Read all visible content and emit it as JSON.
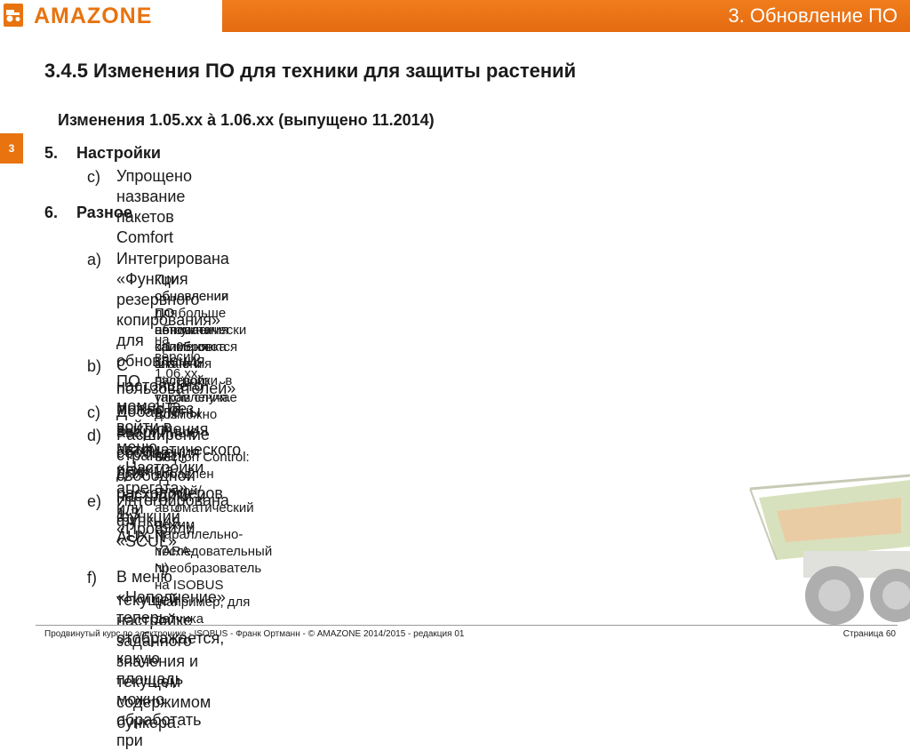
{
  "header": {
    "brand": "AMAZONE",
    "section": "3.  Обновление ПО"
  },
  "chapter_tab": "3",
  "title": "3.4.5 Изменения ПО для техники для защиты растений",
  "subtitle": "Изменения 1.05.xx à 1.06.xx (выпущено 11.2014)",
  "sections": [
    {
      "number": "5.",
      "title": "Настройки",
      "items": [
        {
          "marker": "c)",
          "text": "Упрощено название пакетов Comfort"
        }
      ]
    },
    {
      "number": "6.",
      "title": "Разное",
      "items": [
        {
          "marker": "a)",
          "text": "Интегрирована «Функция резервного копирования» для обновления ПО",
          "sub": [
            "При обновлении ПО автоматически применяются значения настройки, в таком случае для",
            "обновления ПО больше не нужна калибровка штанг и рулевого управления. Возможно",
            "для обновления с 1.05.xx",
            "на версию 1.06.xx."
          ]
        },
        {
          "marker": "b)",
          "text_lines": [
            "С настоящего момента войти в меню «Настройки агрегата» или «Профили",
            "пользователей» можно без выключения автоматического режима"
          ]
        },
        {
          "marker": "c)",
          "text": "Добавлены аварийные сообщения для расходомеров 1-3"
        },
        {
          "marker": "d)",
          "text": "Расширение страниц свободной настройки и функций AUX-N",
          "sub": [
            "Section Control: добавлен ручной/автоматический режим"
          ]
        },
        {
          "marker": "e)",
          "text": "Интегрирована функция «SCUL»",
          "sub": [
            "Параллельно-последовательный преобразователь на ISOBUS (например, для датчика",
            "YARA-N)"
          ]
        },
        {
          "marker": "f)",
          "text_lines": [
            "В меню «Наполнение» теперь отображается, какую площадь можно обработать при",
            "текущей настройке заданного значения и текущем содержимом бункера."
          ]
        }
      ]
    }
  ],
  "sub_marker": "-",
  "footer": {
    "left": "Продвинутый курс по электронике - ISOBUS - Франк Ортманн - © AMAZONE 2014/2015 - редакция 01",
    "right": "Страница 60"
  },
  "colors": {
    "accent": "#e8730f",
    "text": "#1a1a1a"
  }
}
